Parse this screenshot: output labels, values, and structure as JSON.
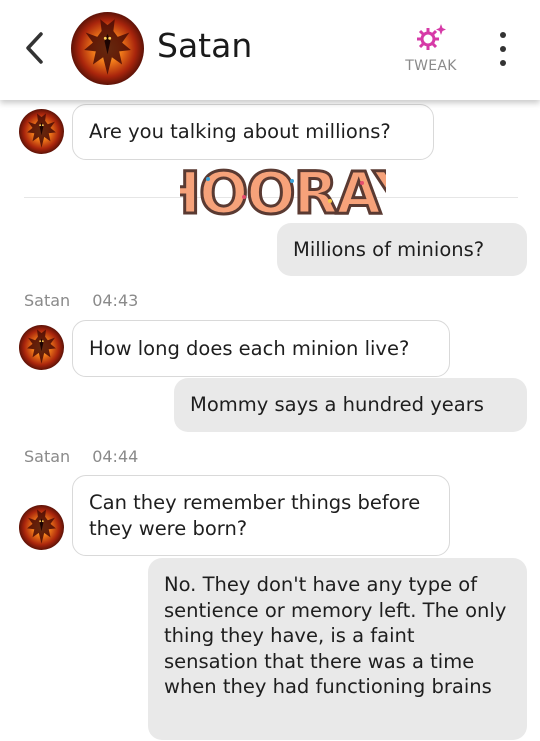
{
  "header": {
    "title": "Satan",
    "tweak_label": "TWEAK"
  },
  "colors": {
    "accent": "#d63aa7",
    "outgoing_bubble": "#e9e9e9",
    "incoming_border": "#d9d9d9",
    "meta_text": "#8a8a8a"
  },
  "icons": {
    "back": "chevron-left-icon",
    "tweak": "sparkle-gear-icon",
    "more": "more-vertical-icon"
  },
  "messages": [
    {
      "text": "Are you talking about millions?"
    },
    {
      "sticker_text": "HOORAY"
    },
    {
      "text": "Millions of minions?"
    },
    {
      "sender": "Satan",
      "time": "04:43"
    },
    {
      "text": "How long does each minion live?"
    },
    {
      "text": "Mommy says a hundred years"
    },
    {
      "sender": "Satan",
      "time": "04:44"
    },
    {
      "text": "Can they remember things before they were born?"
    },
    {
      "text": "No. They don't have any type of sentience or memory left. The only thing they have, is a faint sensation that there was a time when they had functioning brains"
    }
  ]
}
